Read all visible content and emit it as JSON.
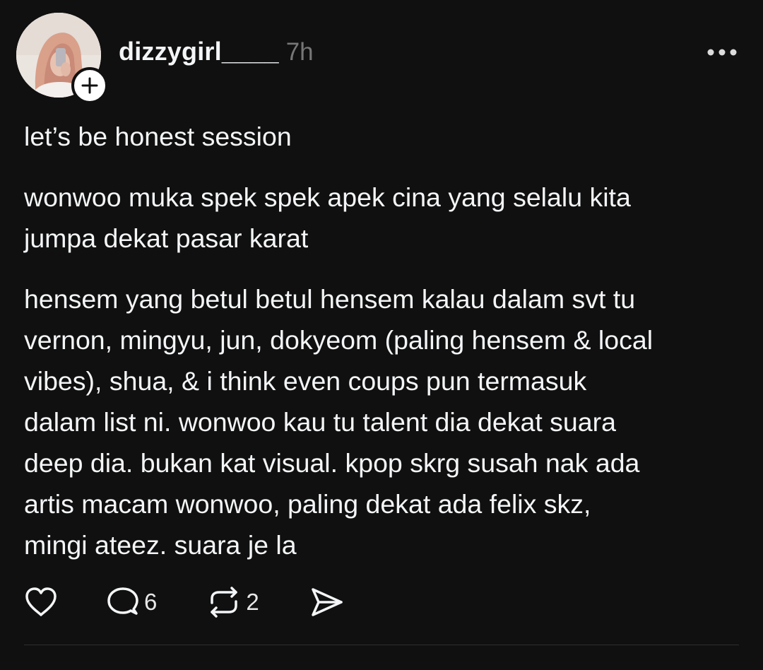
{
  "post": {
    "username": "dizzygirl____",
    "timestamp": "7h",
    "content": {
      "p1": {
        "l1": "let’s be honest session"
      },
      "p2": {
        "l1": "wonwoo muka spek spek apek cina yang selalu kita",
        "l2": "jumpa dekat pasar karat"
      },
      "p3": {
        "l1": "hensem yang betul betul hensem kalau dalam svt tu",
        "l2": "vernon, mingyu, jun, dokyeom (paling hensem & local",
        "l3": "vibes), shua, & i think even coups pun termasuk",
        "l4": "dalam list ni. wonwoo kau tu talent dia dekat suara",
        "l5": "deep dia. bukan kat visual. kpop skrg susah nak ada",
        "l6": "artis macam wonwoo, paling dekat ada felix skz,",
        "l7": "mingi ateez. suara je la"
      }
    },
    "actions": {
      "reply_count": "6",
      "repost_count": "2"
    }
  },
  "icons": {
    "follow": "plus-icon",
    "more": "more-horizontal-icon",
    "like": "heart-icon",
    "reply": "comment-bubble-icon",
    "repost": "repost-icon",
    "share": "send-icon"
  },
  "colors": {
    "background": "#101010",
    "text": "#f3f5f7",
    "muted": "#777777"
  }
}
